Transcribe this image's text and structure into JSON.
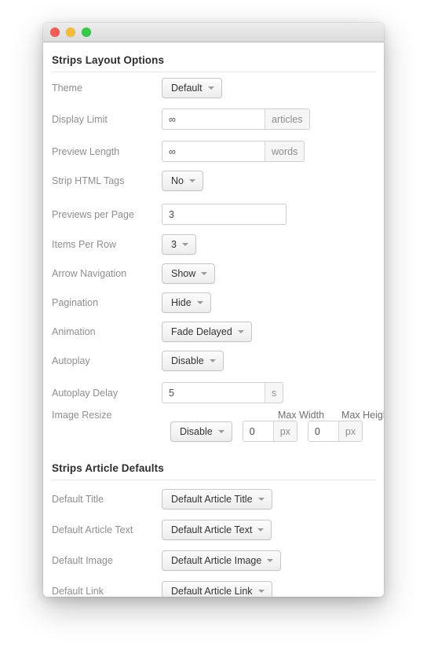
{
  "window": {
    "traffic_lights": [
      "close",
      "minimize",
      "maximize"
    ],
    "colors": {
      "close": "#f75b56",
      "minimize": "#f8bd38",
      "maximize": "#33cc47",
      "label": "#8f8f8f",
      "heading": "#2e2e2e",
      "border": "#c6c6c6"
    }
  },
  "sections": [
    {
      "title": "Strips Layout Options",
      "rows": [
        {
          "label": "Theme",
          "control": "select",
          "value": "Default"
        },
        {
          "label": "Display Limit",
          "control": "input-unit",
          "value": "∞",
          "unit": "articles"
        },
        {
          "label": "Preview Length",
          "control": "input-unit",
          "value": "∞",
          "unit": "words"
        },
        {
          "label": "Strip HTML Tags",
          "control": "select",
          "value": "No"
        },
        {
          "label": "Previews per Page",
          "control": "input",
          "value": "3"
        },
        {
          "label": "Items Per Row",
          "control": "select",
          "value": "3"
        },
        {
          "label": "Arrow Navigation",
          "control": "select",
          "value": "Show"
        },
        {
          "label": "Pagination",
          "control": "select",
          "value": "Hide"
        },
        {
          "label": "Animation",
          "control": "select",
          "value": "Fade Delayed"
        },
        {
          "label": "Autoplay",
          "control": "select",
          "value": "Disable"
        },
        {
          "label": "Autoplay Delay",
          "control": "input-unit",
          "value": "5",
          "unit": "s"
        },
        {
          "label": "Image Resize",
          "control": "resize-group",
          "value": "Disable",
          "max_width": {
            "header": "Max Width",
            "value": "0",
            "unit": "px"
          },
          "max_height": {
            "header": "Max Height",
            "value": "0",
            "unit": "px"
          }
        }
      ]
    },
    {
      "title": "Strips Article Defaults",
      "rows": [
        {
          "label": "Default Title",
          "control": "select",
          "value": "Default Article Title"
        },
        {
          "label": "Default Article Text",
          "control": "select",
          "value": "Default Article Text"
        },
        {
          "label": "Default Image",
          "control": "select",
          "value": "Default Article Image"
        },
        {
          "label": "Default Link",
          "control": "select",
          "value": "Default Article Link"
        }
      ]
    }
  ]
}
